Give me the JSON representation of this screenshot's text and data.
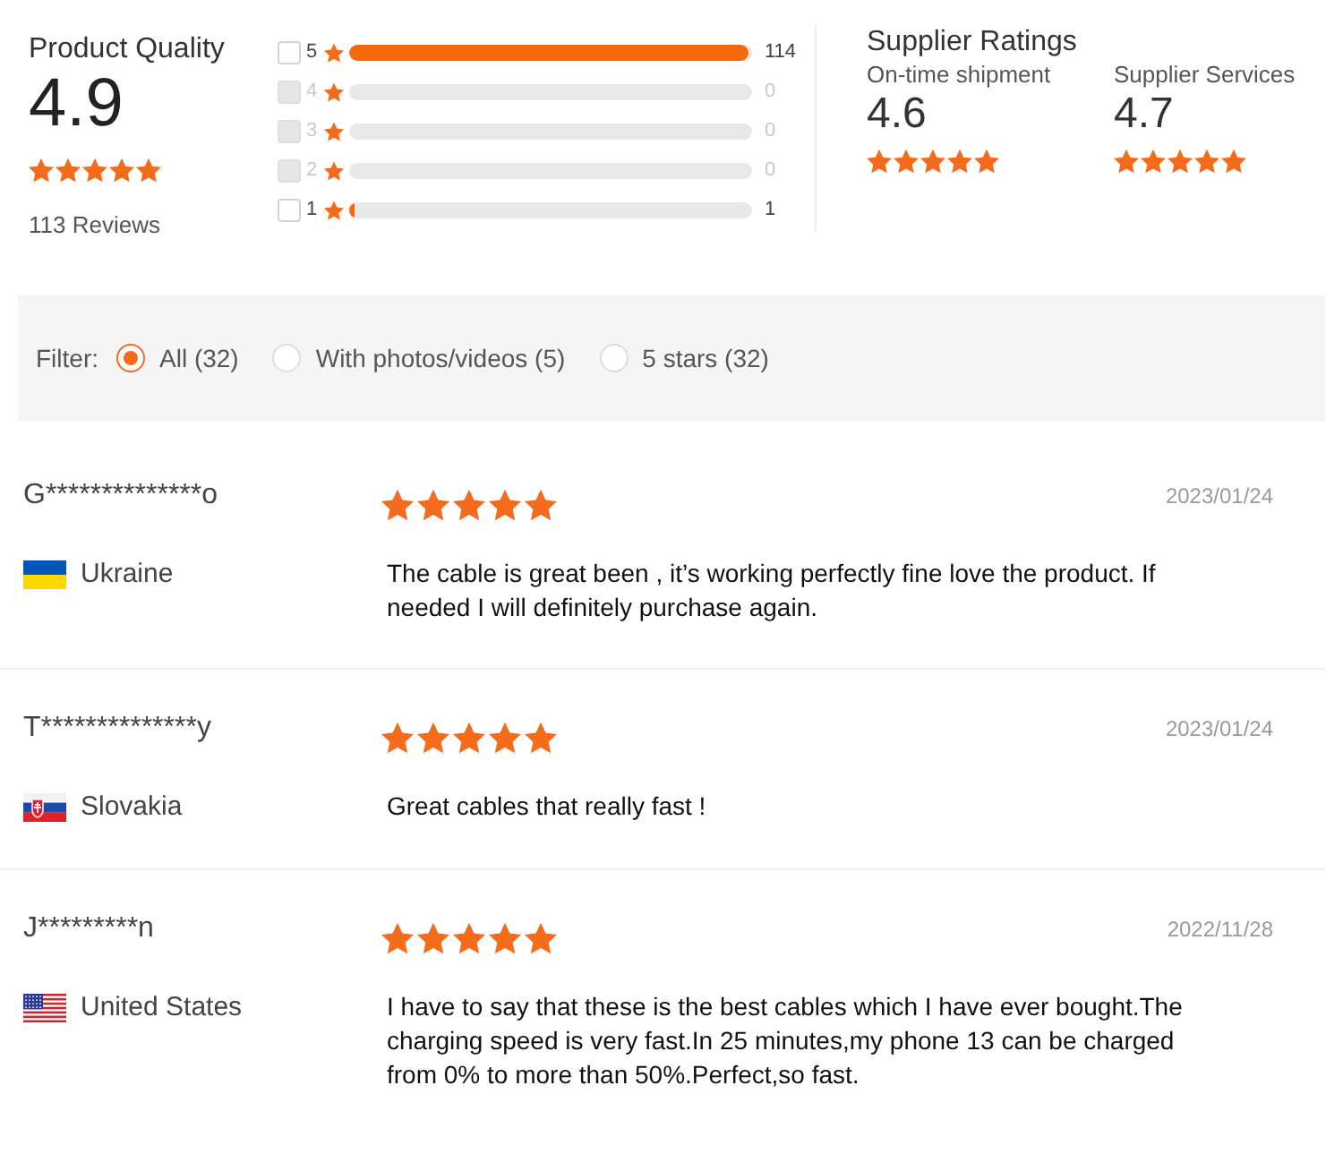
{
  "product_quality": {
    "title": "Product Quality",
    "score": "4.9",
    "stars": 5,
    "reviews": "113 Reviews"
  },
  "histogram": [
    {
      "label": "5",
      "count": "114",
      "level": 0.99,
      "checked": false,
      "disabled": false
    },
    {
      "label": "4",
      "count": "0",
      "checked": false,
      "disabled": true
    },
    {
      "label": "3",
      "count": "0",
      "checked": false,
      "disabled": true
    },
    {
      "label": "2",
      "count": "0",
      "checked": false,
      "disabled": true
    },
    {
      "label": "1",
      "count": "1",
      "level": 0.01,
      "checked": false,
      "disabled": false
    }
  ],
  "supplier_ratings": {
    "title": "Supplier Ratings",
    "items": [
      {
        "label": "On-time shipment",
        "score": "4.6",
        "stars": 5
      },
      {
        "label": "Supplier Services",
        "score": "4.7",
        "stars": 5
      }
    ]
  },
  "filter": {
    "label": "Filter:",
    "options": [
      {
        "label": "All (32)",
        "selected": true
      },
      {
        "label": "With photos/videos (5)",
        "selected": false
      },
      {
        "label": "5 stars (32)",
        "selected": false
      }
    ]
  },
  "reviews": [
    {
      "name": "G**************o",
      "stars": 5,
      "date": "2023/01/24",
      "kind": "ua",
      "country": "Ukraine",
      "text": "The cable is great been , it’s working perfectly fine love the product. If needed I will definitely purchase again."
    },
    {
      "name": "T**************y",
      "stars": 5,
      "date": "2023/01/24",
      "kind": "sk",
      "country": "Slovakia",
      "text": "Great cables that really fast !"
    },
    {
      "name": "J*********n",
      "stars": 5,
      "date": "2022/11/28",
      "kind": "us",
      "country": "United States",
      "text": "I have to say that these is the best cables which I have ever bought.The charging speed is very fast.In 25 minutes,my phone 13 can be charged from 0% to more than 50%.Perfect,so fast."
    }
  ]
}
